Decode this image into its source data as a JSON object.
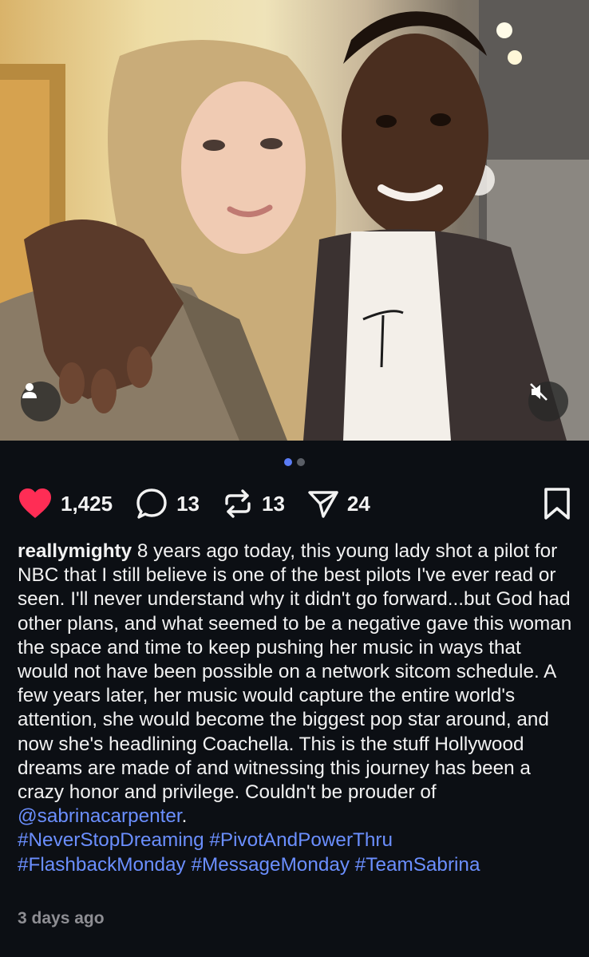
{
  "post": {
    "photo_alt": "Selfie photo",
    "carousel": {
      "count": 2,
      "active_index": 0,
      "active_color": "#5b7cf5",
      "inactive_color": "#5a5e66"
    },
    "actions": {
      "likes": "1,425",
      "comments": "13",
      "reposts": "13",
      "shares": "24",
      "like_color": "#ff2d55"
    },
    "caption": {
      "username": "reallymighty",
      "text_1": " 8 years ago today, this young lady shot a pilot for NBC that I still believe is one of the best pilots I've ever read or seen. I'll never understand why it didn't go forward...but God had other plans, and what seemed to be a negative gave this woman the space and time to keep pushing her music in ways that would not have been possible on a network sitcom schedule. A few years later, her music would capture the entire world's attention, she would become the biggest pop star around, and now she's headlining Coachella. This is the stuff Hollywood dreams are made of and witnessing this journey has been a crazy honor and privilege. Couldn't be prouder of ",
      "mention": "@sabrinacarpenter",
      "text_2": ".",
      "hashtags": [
        "#NeverStopDreaming",
        "#PivotAndPowerThru",
        "#FlashbackMonday",
        "#MessageMonday",
        "#TeamSabrina"
      ]
    },
    "timestamp": "3 days ago"
  },
  "icons": {
    "profile": "person-icon",
    "mute": "speaker-muted-icon",
    "like": "heart-icon",
    "comment": "comment-bubble-icon",
    "repost": "repost-arrows-icon",
    "share": "paper-plane-icon",
    "save": "bookmark-icon"
  }
}
